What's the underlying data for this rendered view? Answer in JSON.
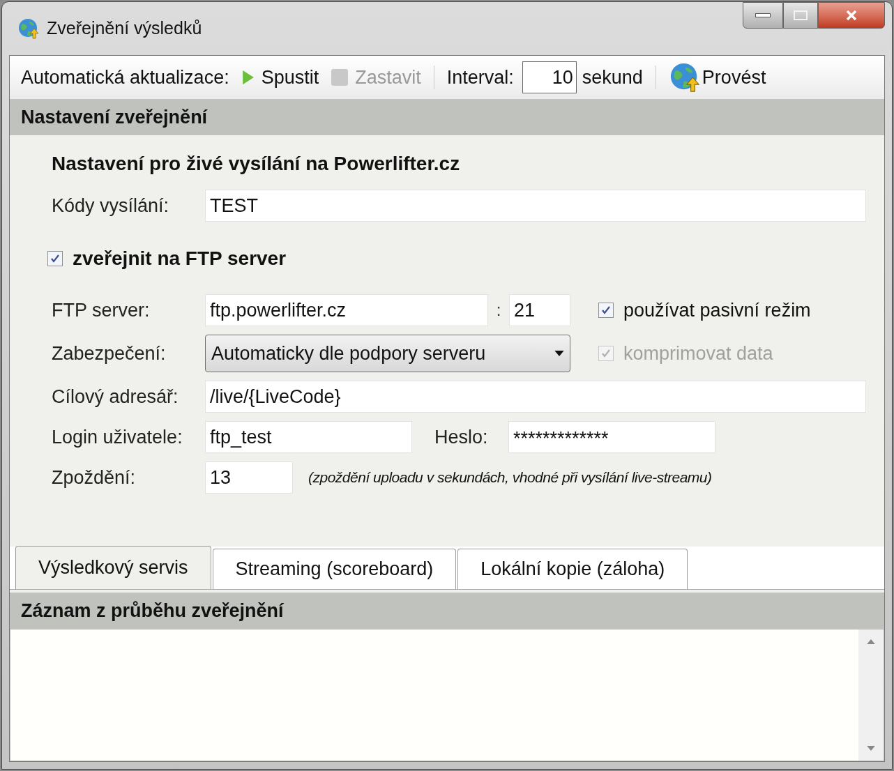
{
  "window": {
    "title": "Zveřejnění výsledků"
  },
  "toolbar": {
    "label": "Automatická aktualizace:",
    "start": {
      "label": "Spustit",
      "disabled": false
    },
    "stop": {
      "label": "Zastavit",
      "disabled": true
    },
    "interval_label": "Interval:",
    "interval_value": "10",
    "interval_unit": "sekund",
    "run": {
      "label": "Provést",
      "disabled": false
    }
  },
  "settings": {
    "title": "Nastavení zveřejnění",
    "heading": "Nastavení pro živé vysílání na Powerlifter.cz",
    "codes": {
      "label": "Kódy vysílání:",
      "value": "TEST"
    },
    "publish_ftp": {
      "label": "zveřejnit na FTP server",
      "checked": true,
      "disabled": false
    },
    "ftp_server": {
      "label": "FTP server:",
      "value": "ftp.powerlifter.cz",
      "separator": ":",
      "port": "21"
    },
    "passive": {
      "label": "používat pasivní režim",
      "checked": true,
      "disabled": false
    },
    "security": {
      "label": "Zabezpečení:",
      "value": "Automaticky dle podpory serveru"
    },
    "compress": {
      "label": "komprimovat data",
      "checked": true,
      "disabled": true
    },
    "target_dir": {
      "label": "Cílový adresář:",
      "value": "/live/{LiveCode}"
    },
    "login": {
      "label": "Login uživatele:",
      "value": "ftp_test"
    },
    "password": {
      "label": "Heslo:",
      "value": "*************"
    },
    "delay": {
      "label": "Zpoždění:",
      "value": "13",
      "note": "(zpoždění uploadu v sekundách, vhodné při vysílání live-streamu)"
    }
  },
  "tabs": [
    {
      "label": "Výsledkový servis",
      "selected": true
    },
    {
      "label": "Streaming (scoreboard)",
      "selected": false
    },
    {
      "label": "Lokální kopie (záloha)",
      "selected": false
    }
  ],
  "log": {
    "title": "Záznam z průběhu zveřejnění"
  }
}
